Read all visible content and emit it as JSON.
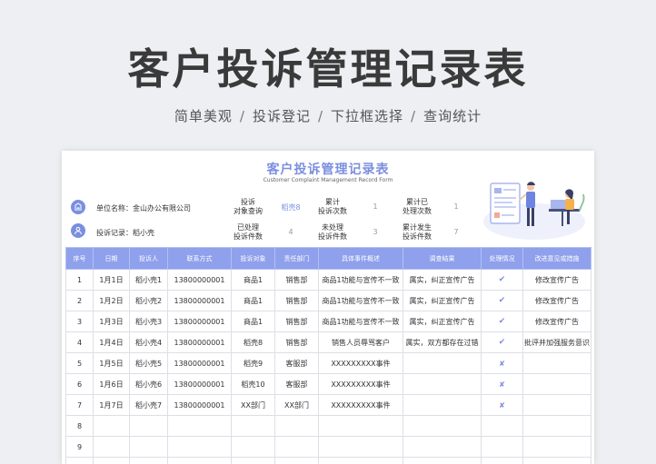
{
  "hero": {
    "title": "客户投诉管理记录表",
    "features": [
      "简单美观",
      "投诉登记",
      "下拉框选择",
      "查询统计"
    ],
    "separator": "/"
  },
  "sheet": {
    "title": "客户投诉管理记录表",
    "subtitle": "Customer Complaint Management Record Form",
    "unit_name": "单位名称：金山办公有限公司",
    "recorder": "投诉记录：稻小壳",
    "stats": {
      "query_target_label": "投诉\n对象查询",
      "query_target_value": "稻壳8",
      "total_label": "累计\n投诉次数",
      "total_value": "1",
      "resolved_total_label": "累计已\n处理次数",
      "resolved_total_value": "1",
      "processed_label": "已处理\n投诉件数",
      "processed_value": "4",
      "unprocessed_label": "未处理\n投诉件数",
      "unprocessed_value": "3",
      "occurred_label": "累计发生\n投诉件数",
      "occurred_value": "7"
    }
  },
  "table": {
    "headers": [
      "序号",
      "日期",
      "投诉人",
      "联系方式",
      "投诉对象",
      "责任部门",
      "具体事件概述",
      "调查结果",
      "处理情况",
      "改进意见或措施"
    ],
    "rows": [
      {
        "no": "1",
        "date": "1月1日",
        "person": "稻小壳1",
        "contact": "13800000001",
        "target": "商品1",
        "dept": "销售部",
        "event": "商品1功能与宣传不一致",
        "result": "属实，纠正宣传广告",
        "status": "✔",
        "improve": "修改宣传广告"
      },
      {
        "no": "2",
        "date": "1月2日",
        "person": "稻小壳2",
        "contact": "13800000001",
        "target": "商品1",
        "dept": "销售部",
        "event": "商品1功能与宣传不一致",
        "result": "属实，纠正宣传广告",
        "status": "✔",
        "improve": "修改宣传广告"
      },
      {
        "no": "3",
        "date": "1月3日",
        "person": "稻小壳3",
        "contact": "13800000001",
        "target": "商品1",
        "dept": "销售部",
        "event": "商品1功能与宣传不一致",
        "result": "属实，纠正宣传广告",
        "status": "✔",
        "improve": "修改宣传广告"
      },
      {
        "no": "4",
        "date": "1月4日",
        "person": "稻小壳4",
        "contact": "13800000001",
        "target": "稻壳8",
        "dept": "销售部",
        "event": "销售人员辱骂客户",
        "result": "属实，双方都存在过错",
        "status": "✔",
        "improve": "批评并加强服务意识"
      },
      {
        "no": "5",
        "date": "1月5日",
        "person": "稻小壳5",
        "contact": "13800000001",
        "target": "稻壳9",
        "dept": "客服部",
        "event": "XXXXXXXXX事件",
        "result": "",
        "status": "✘",
        "improve": ""
      },
      {
        "no": "6",
        "date": "1月6日",
        "person": "稻小壳6",
        "contact": "13800000001",
        "target": "稻壳10",
        "dept": "客服部",
        "event": "XXXXXXXXX事件",
        "result": "",
        "status": "✘",
        "improve": ""
      },
      {
        "no": "7",
        "date": "1月7日",
        "person": "稻小壳7",
        "contact": "13800000001",
        "target": "XX部门",
        "dept": "XX部门",
        "event": "XXXXXXXXX事件",
        "result": "",
        "status": "✘",
        "improve": ""
      },
      {
        "no": "8",
        "date": "",
        "person": "",
        "contact": "",
        "target": "",
        "dept": "",
        "event": "",
        "result": "",
        "status": "",
        "improve": ""
      },
      {
        "no": "9",
        "date": "",
        "person": "",
        "contact": "",
        "target": "",
        "dept": "",
        "event": "",
        "result": "",
        "status": "",
        "improve": ""
      },
      {
        "no": "",
        "date": "",
        "person": "",
        "contact": "",
        "target": "",
        "dept": "",
        "event": "",
        "result": "",
        "status": "",
        "improve": ""
      }
    ]
  },
  "colors": {
    "accent": "#7b8fe0",
    "header_bg": "#8fa0ec",
    "page_bg": "#edeff2"
  },
  "icons": {
    "unit": "building-icon",
    "recorder": "user-icon",
    "status_done": "check-icon",
    "status_pending": "cross-icon"
  }
}
